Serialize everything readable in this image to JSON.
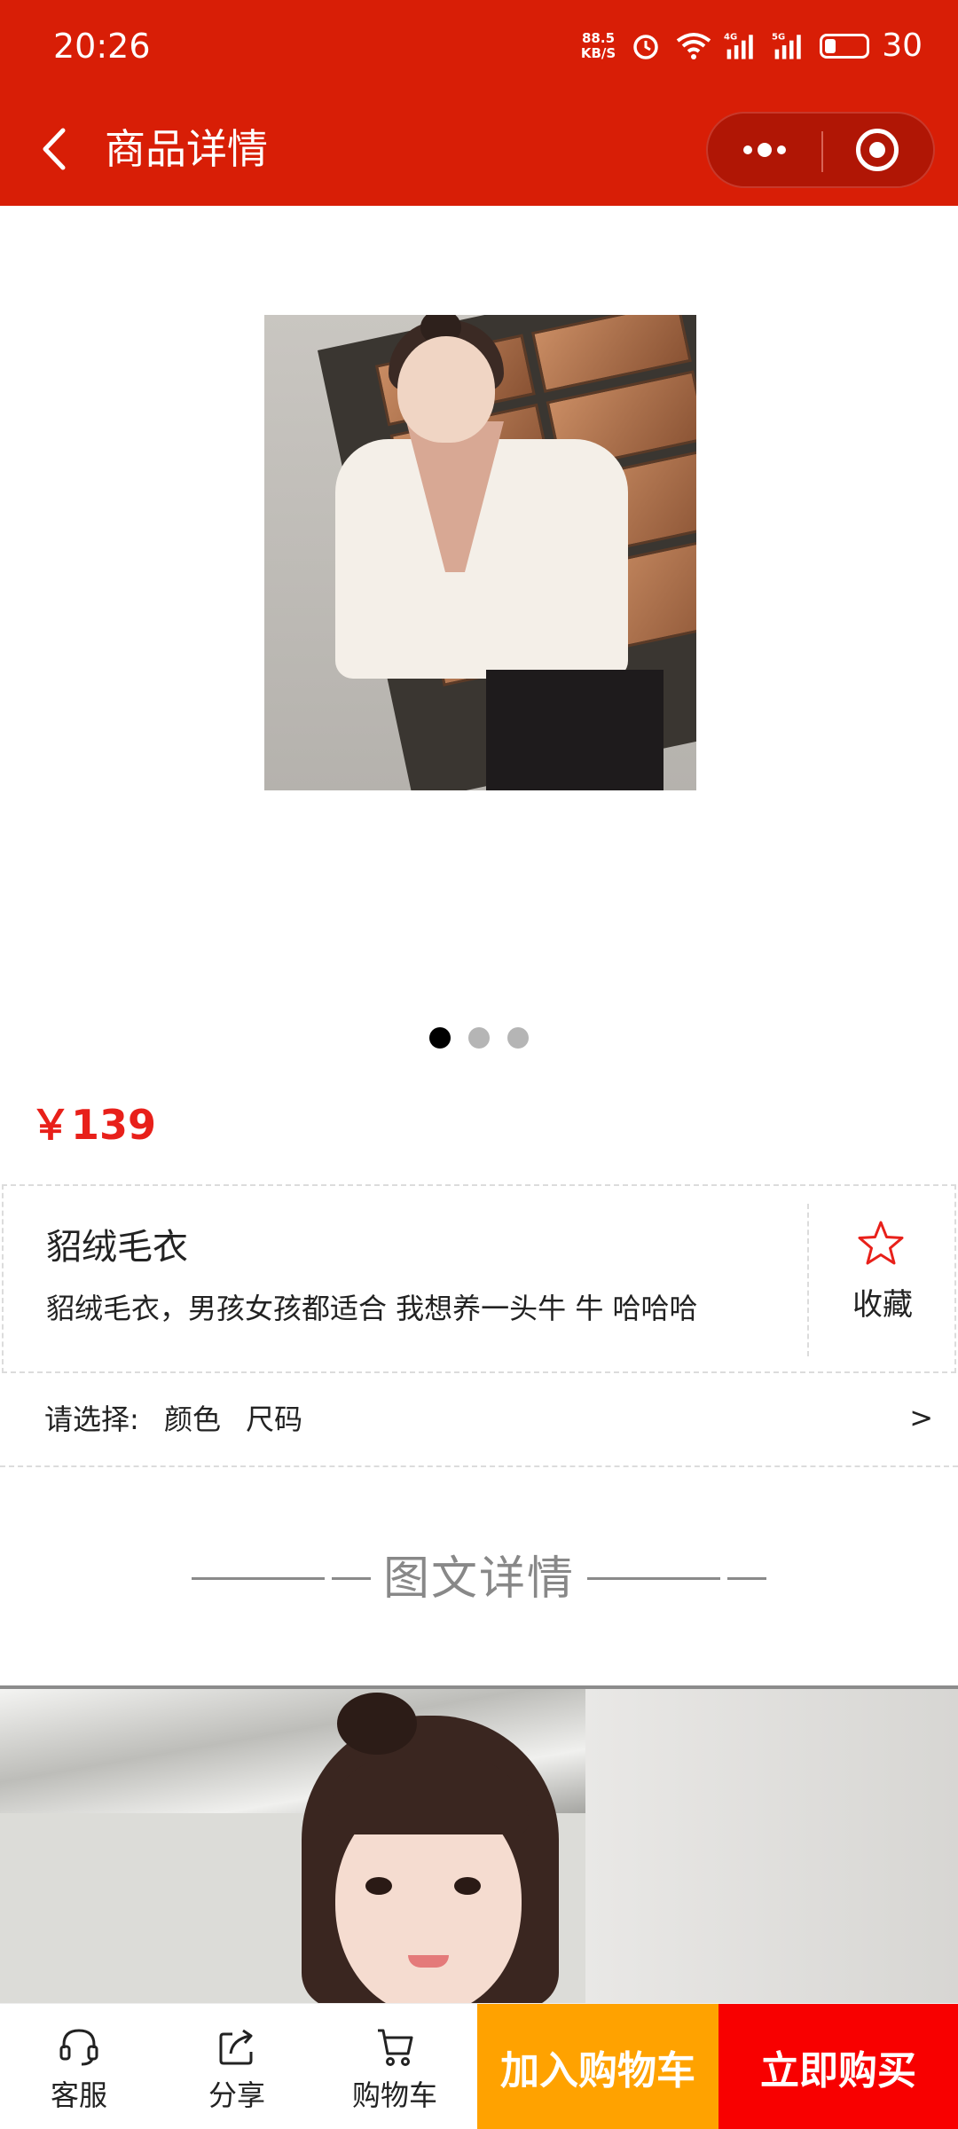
{
  "status_bar": {
    "time": "20:26",
    "net_speed": "88.5",
    "net_unit": "KB/S",
    "signal_1": "4G",
    "signal_2": "5G",
    "battery": "30"
  },
  "nav": {
    "title": "商品详情"
  },
  "carousel": {
    "count": 3,
    "active_index": 0
  },
  "product": {
    "price": "￥139",
    "name": "貂绒毛衣",
    "description": "貂绒毛衣，男孩女孩都适合 我想养一头牛 牛 哈哈哈",
    "favorite_label": "收藏"
  },
  "spec_select": {
    "label": "请选择:",
    "options": [
      "颜色",
      "尺码"
    ],
    "arrow": ">"
  },
  "detail_section": {
    "title": "图文详情"
  },
  "bottom_bar": {
    "service_label": "客服",
    "share_label": "分享",
    "cart_label": "购物车",
    "add_to_cart_label": "加入购物车",
    "buy_now_label": "立即购买"
  },
  "colors": {
    "brand_red": "#d81e06",
    "price_red": "#e8201a",
    "cart_orange": "#ffa200",
    "buy_red": "#f80000"
  }
}
